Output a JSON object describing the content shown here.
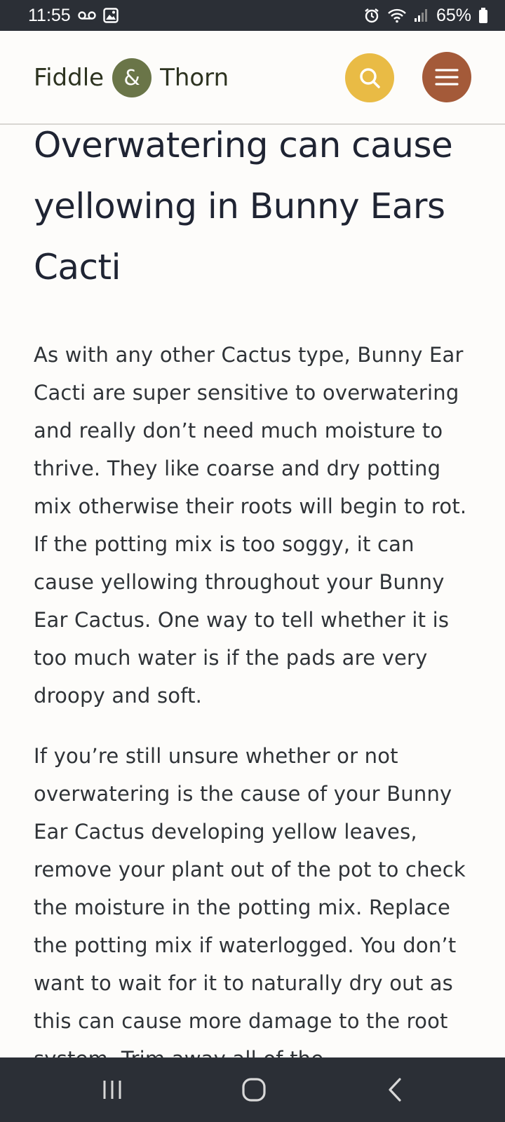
{
  "status_bar": {
    "time": "11:55",
    "battery": "65%",
    "icons": [
      "voicemail-icon",
      "gallery-icon",
      "alarm-icon",
      "wifi-icon",
      "signal-icon",
      "battery-icon"
    ]
  },
  "header": {
    "logo_left": "Fiddle",
    "logo_amp": "&",
    "logo_right": "Thorn",
    "colors": {
      "search": "#e9bb45",
      "menu": "#a45a39",
      "logo_circle": "#6a7548"
    }
  },
  "article": {
    "heading": "Overwatering can cause yellowing in Bunny Ears Cacti",
    "paragraphs": [
      "As with any other Cactus type, Bunny Ear Cacti are super sensitive to overwatering and really don’t need much moisture to thrive. They like coarse and dry potting mix otherwise their roots will begin to rot. If the potting mix is too soggy, it can cause yellowing throughout your Bunny Ear Cactus. One way to tell whether it is too much water is if the pads are very droopy and soft.",
      "If you’re still unsure whether or not overwatering is the cause of your Bunny Ear Cactus developing yellow leaves, remove your plant out of the pot to check the moisture in the potting mix. Replace the potting mix if waterlogged. You don’t want to wait for it to naturally dry out as this can cause more damage to the root system. Trim away all of the"
    ]
  },
  "nav_bar": {
    "icons": [
      "recent-apps-icon",
      "home-icon",
      "back-icon"
    ]
  }
}
